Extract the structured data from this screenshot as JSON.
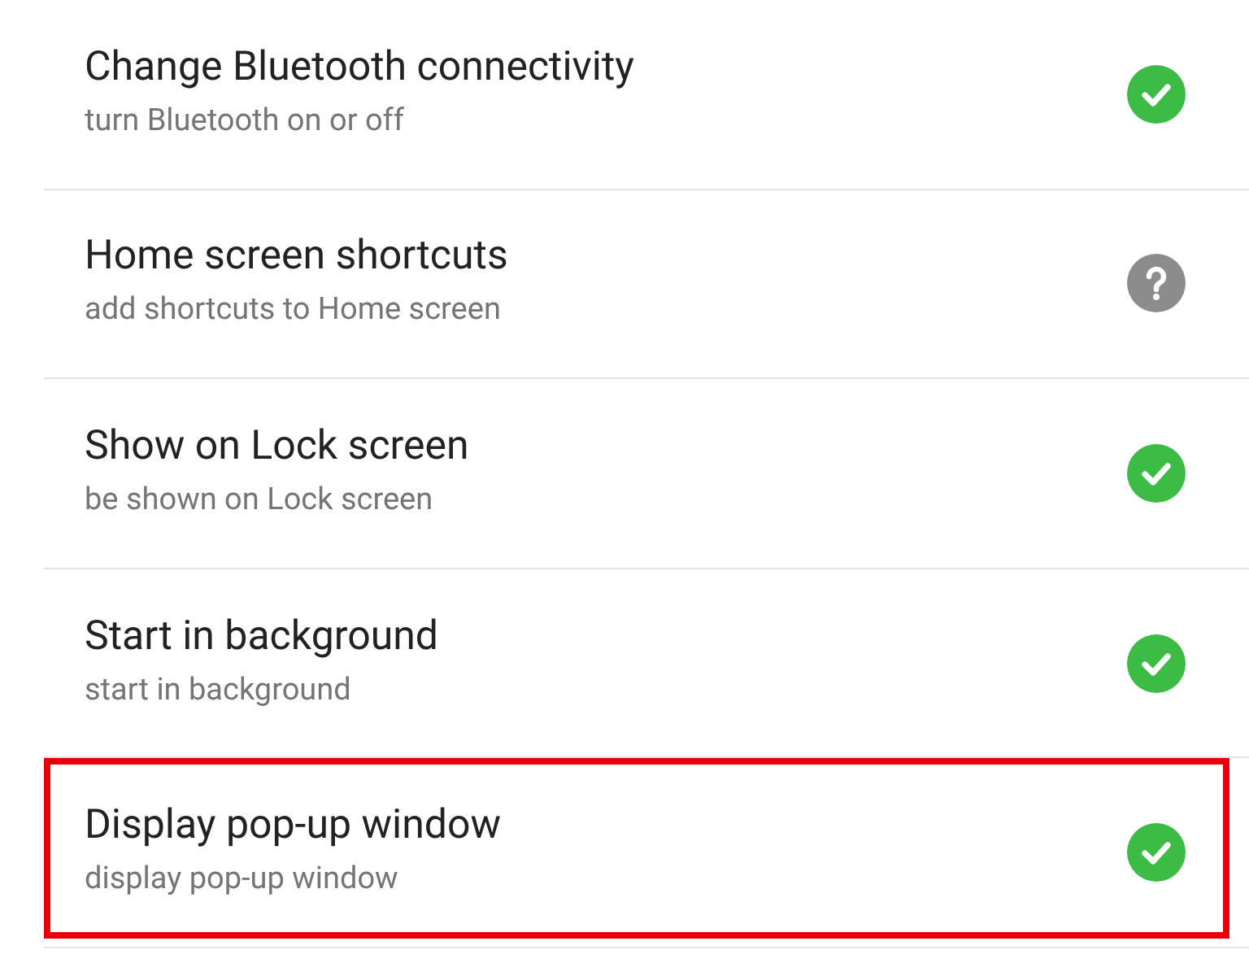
{
  "permissions": [
    {
      "title": "Change Bluetooth connectivity",
      "subtitle": "turn Bluetooth on or off",
      "kind": "granted",
      "highlighted": false
    },
    {
      "title": "Home screen shortcuts",
      "subtitle": "add shortcuts to Home screen",
      "kind": "unknown",
      "highlighted": false
    },
    {
      "title": "Show on Lock screen",
      "subtitle": "be shown on Lock screen",
      "kind": "granted",
      "highlighted": false
    },
    {
      "title": "Start in background",
      "subtitle": "start in background",
      "kind": "granted",
      "highlighted": false
    },
    {
      "title": "Display pop-up window",
      "subtitle": "display pop-up window",
      "kind": "granted",
      "highlighted": true
    }
  ]
}
